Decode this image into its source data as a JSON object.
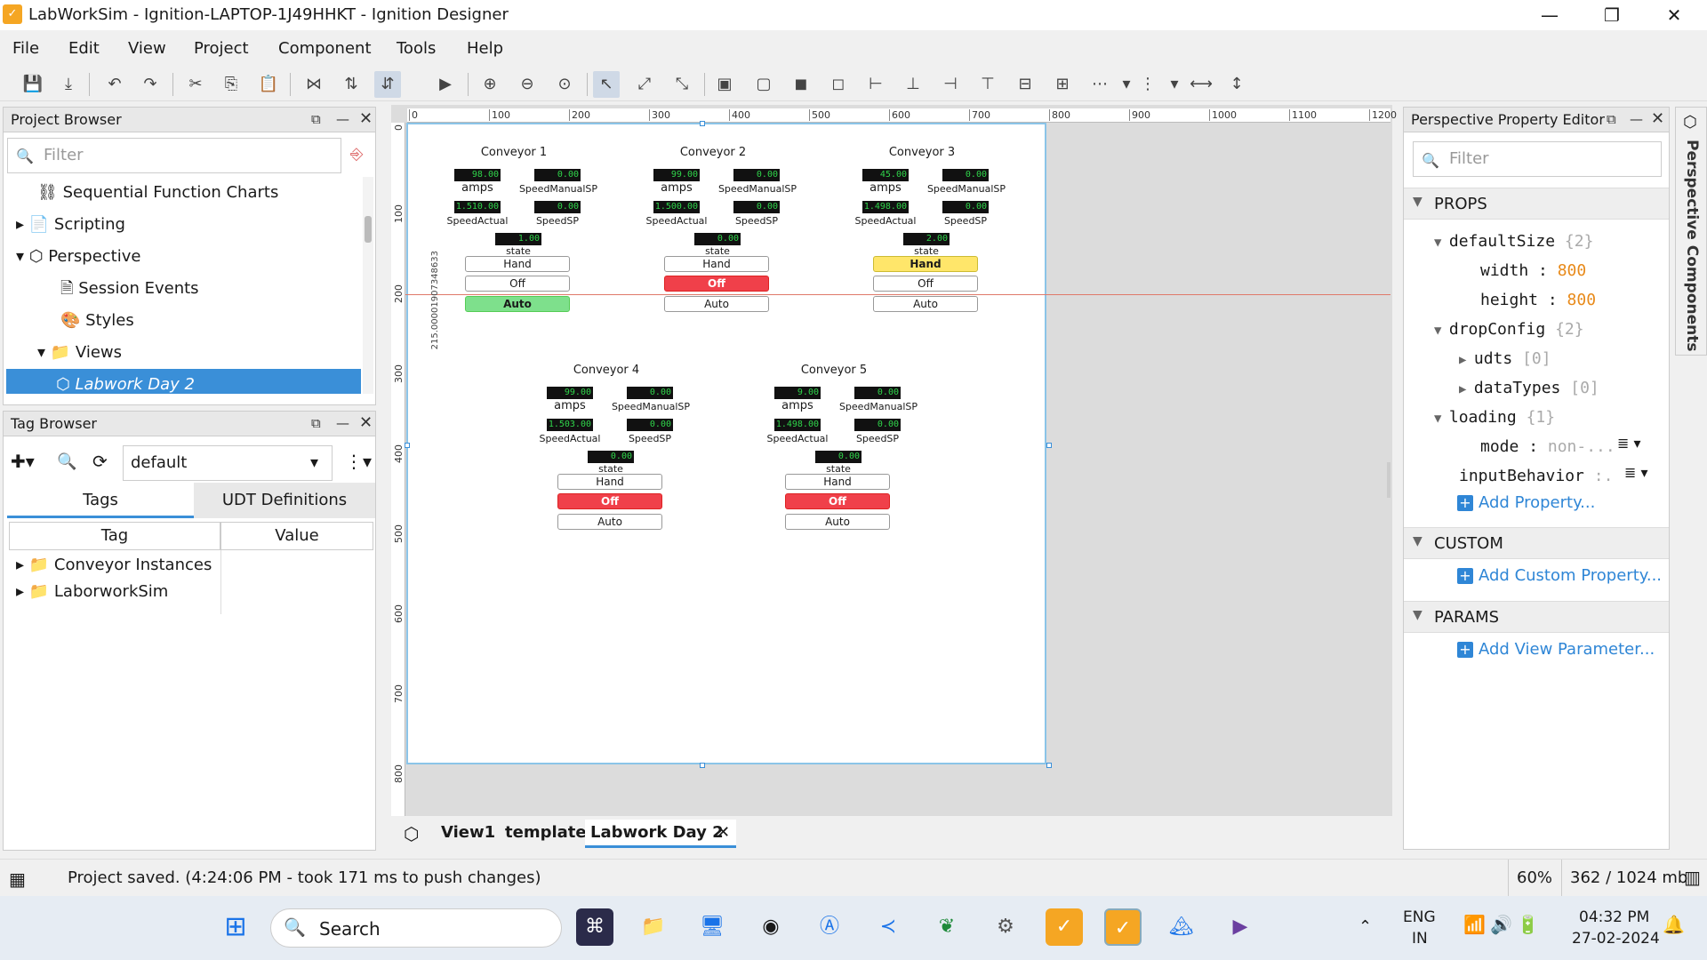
{
  "window": {
    "title": "LabWorkSim - Ignition-LAPTOP-1J49HHKT - Ignition Designer",
    "minimize": "—",
    "maximize": "❐",
    "close": "✕"
  },
  "menu": [
    "File",
    "Edit",
    "View",
    "Project",
    "Component",
    "Tools",
    "Help"
  ],
  "project_browser": {
    "title": "Project Browser",
    "filter_placeholder": "Filter",
    "items": [
      {
        "label": "Sequential Function Charts",
        "indent": 1
      },
      {
        "label": "Scripting",
        "indent": 1
      },
      {
        "label": "Perspective",
        "indent": 1
      },
      {
        "label": "Session Events",
        "indent": 2
      },
      {
        "label": "Styles",
        "indent": 2
      },
      {
        "label": "Views",
        "indent": 2
      },
      {
        "label": "Labwork Day 2",
        "indent": 3,
        "selected": true
      }
    ]
  },
  "tag_browser": {
    "title": "Tag Browser",
    "provider": "default",
    "tabs": [
      "Tags",
      "UDT Definitions"
    ],
    "columns": [
      "Tag",
      "Value"
    ],
    "rows": [
      "Conveyor Instances",
      "LaborworkSim"
    ]
  },
  "canvas": {
    "ruler_h": [
      "0",
      "100",
      "200",
      "300",
      "400",
      "500",
      "600",
      "700",
      "800",
      "900",
      "1000",
      "1100",
      "1200"
    ],
    "ruler_v": [
      "0",
      "100",
      "200",
      "300",
      "400",
      "500",
      "600",
      "700",
      "800"
    ],
    "guide_label": "215.00001907348633",
    "conveyors": [
      {
        "title": "Conveyor 1",
        "amps": "98.00",
        "speed_manual_sp": "0.00",
        "speed_actual": "1.510.00",
        "speed_sp": "0.00",
        "state": "1.00",
        "mode": "auto"
      },
      {
        "title": "Conveyor 2",
        "amps": "99.00",
        "speed_manual_sp": "0.00",
        "speed_actual": "1.500.00",
        "speed_sp": "0.00",
        "state": "0.00",
        "mode": "off"
      },
      {
        "title": "Conveyor 3",
        "amps": "45.00",
        "speed_manual_sp": "0.00",
        "speed_actual": "1.498.00",
        "speed_sp": "0.00",
        "state": "2.00",
        "mode": "hand"
      },
      {
        "title": "Conveyor 4",
        "amps": "99.00",
        "speed_manual_sp": "0.00",
        "speed_actual": "1.503.00",
        "speed_sp": "0.00",
        "state": "0.00",
        "mode": "off"
      },
      {
        "title": "Conveyor 5",
        "amps": "9.00",
        "speed_manual_sp": "0.00",
        "speed_actual": "1.498.00",
        "speed_sp": "0.00",
        "state": "0.00",
        "mode": "off"
      }
    ],
    "labels": {
      "amps": "amps",
      "speed_manual_sp": "SpeedManualSP",
      "speed_actual": "SpeedActual",
      "speed_sp": "SpeedSP",
      "state": "state",
      "hand": "Hand",
      "off": "Off",
      "auto": "Auto"
    }
  },
  "view_tabs": {
    "items": [
      "View1",
      "template",
      "Labwork Day 2"
    ],
    "active": "Labwork Day 2"
  },
  "property_editor": {
    "title": "Perspective Property Editor",
    "filter_placeholder": "Filter",
    "sections": {
      "props": "PROPS",
      "custom": "CUSTOM",
      "params": "PARAMS"
    },
    "props": {
      "defaultSize": {
        "name": "defaultSize",
        "count": "{2}"
      },
      "width": {
        "name": "width",
        "value": "800"
      },
      "height": {
        "name": "height",
        "value": "800"
      },
      "dropConfig": {
        "name": "dropConfig",
        "count": "{2}"
      },
      "udts": {
        "name": "udts",
        "count": "[0]"
      },
      "dataTypes": {
        "name": "dataTypes",
        "count": "[0]"
      },
      "loading": {
        "name": "loading",
        "count": "{1}"
      },
      "mode": {
        "name": "mode",
        "value": "non-..."
      },
      "inputBehavior": {
        "name": "inputBehavior",
        "value": ":."
      }
    },
    "add_property": "Add Property...",
    "add_custom": "Add Custom Property...",
    "add_param": "Add View Parameter..."
  },
  "side_strip": "Perspective Components",
  "status": {
    "message": "Project saved. (4:24:06 PM - took 171 ms to push changes)",
    "zoom": "60%",
    "memory": "362 / 1024 mb"
  },
  "taskbar": {
    "search": "Search",
    "lang1": "ENG",
    "lang2": "IN",
    "time": "04:32 PM",
    "date": "27-02-2024"
  }
}
